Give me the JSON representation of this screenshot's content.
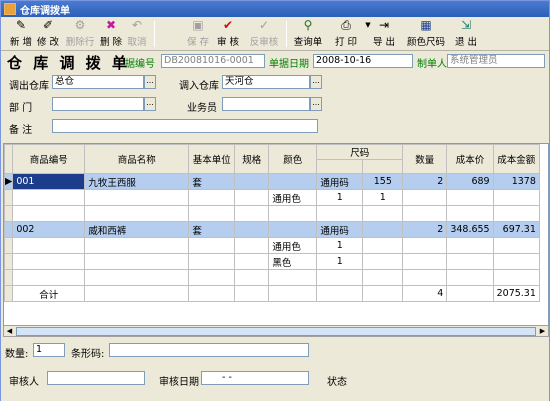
{
  "window": {
    "title": "仓库调拨单"
  },
  "toolbar": {
    "new": "新 增",
    "edit": "修 改",
    "delete_row": "删除行",
    "delete": "删 除",
    "cancel": "取消",
    "save": "保 存",
    "approve": "审 核",
    "unapprove": "反审核",
    "query": "查询单",
    "print": "打 印",
    "export": "导 出",
    "color_size": "颜色尺码",
    "exit": "退 出"
  },
  "form": {
    "doc_title": "仓 库 调 拨 单",
    "doc_no_label": "据编号",
    "doc_no": "DB20081016-0001",
    "date_label": "单据日期",
    "date": "2008-10-16",
    "maker_label": "制单人",
    "maker": "系统管理员",
    "out_wh_label": "调出仓库",
    "out_wh": "总仓",
    "in_wh_label": "调入仓库",
    "in_wh": "天河仓",
    "dept_label": "部    门",
    "dept": "",
    "salesman_label": "业务员",
    "salesman": "",
    "remark_label": "备    注",
    "remark": ""
  },
  "grid": {
    "headers": [
      "商品编号",
      "商品名称",
      "基本单位",
      "规格",
      "颜色",
      "尺码",
      "数量",
      "成本价",
      "成本金额"
    ],
    "rows": [
      {
        "code": "001",
        "name": "九牧王西服",
        "unit": "套",
        "spec": "",
        "color": "",
        "size_name": "通用码",
        "size_val": "155",
        "qty": "2",
        "price": "689",
        "amount": "1378"
      },
      {
        "code": "",
        "name": "",
        "unit": "",
        "spec": "",
        "color": "通用色",
        "size_name": "1",
        "size_val": "1",
        "qty": "",
        "price": "",
        "amount": ""
      },
      {
        "code": "",
        "name": "",
        "unit": "",
        "spec": "",
        "color": "",
        "size_name": "",
        "size_val": "",
        "qty": "",
        "price": "",
        "amount": ""
      },
      {
        "code": "002",
        "name": "威和西裤",
        "unit": "套",
        "spec": "",
        "color": "",
        "size_name": "通用码",
        "size_val": "",
        "qty": "2",
        "price": "348.655",
        "amount": "697.31"
      },
      {
        "code": "",
        "name": "",
        "unit": "",
        "spec": "",
        "color": "通用色",
        "size_name": "1",
        "size_val": "",
        "qty": "",
        "price": "",
        "amount": ""
      },
      {
        "code": "",
        "name": "",
        "unit": "",
        "spec": "",
        "color": "黑色",
        "size_name": "1",
        "size_val": "",
        "qty": "",
        "price": "",
        "amount": ""
      },
      {
        "code": "",
        "name": "",
        "unit": "",
        "spec": "",
        "color": "",
        "size_name": "",
        "size_val": "",
        "qty": "",
        "price": "",
        "amount": ""
      }
    ],
    "total_label": "合计",
    "total_qty": "4",
    "total_amount": "2075.31"
  },
  "bottom": {
    "qty_label": "数量:",
    "qty_value": "1",
    "barcode_label": "条形码:",
    "barcode_value": "",
    "auditor_label": "审核人",
    "auditor": "",
    "audit_date_label": "审核日期",
    "audit_date": "-    -",
    "status_label": "状态"
  },
  "colors": {
    "title_bar": "#2c5fb8",
    "selected_row": "#b5ceef",
    "current_cell": "#1c3c8c",
    "label_green": "#008000"
  }
}
